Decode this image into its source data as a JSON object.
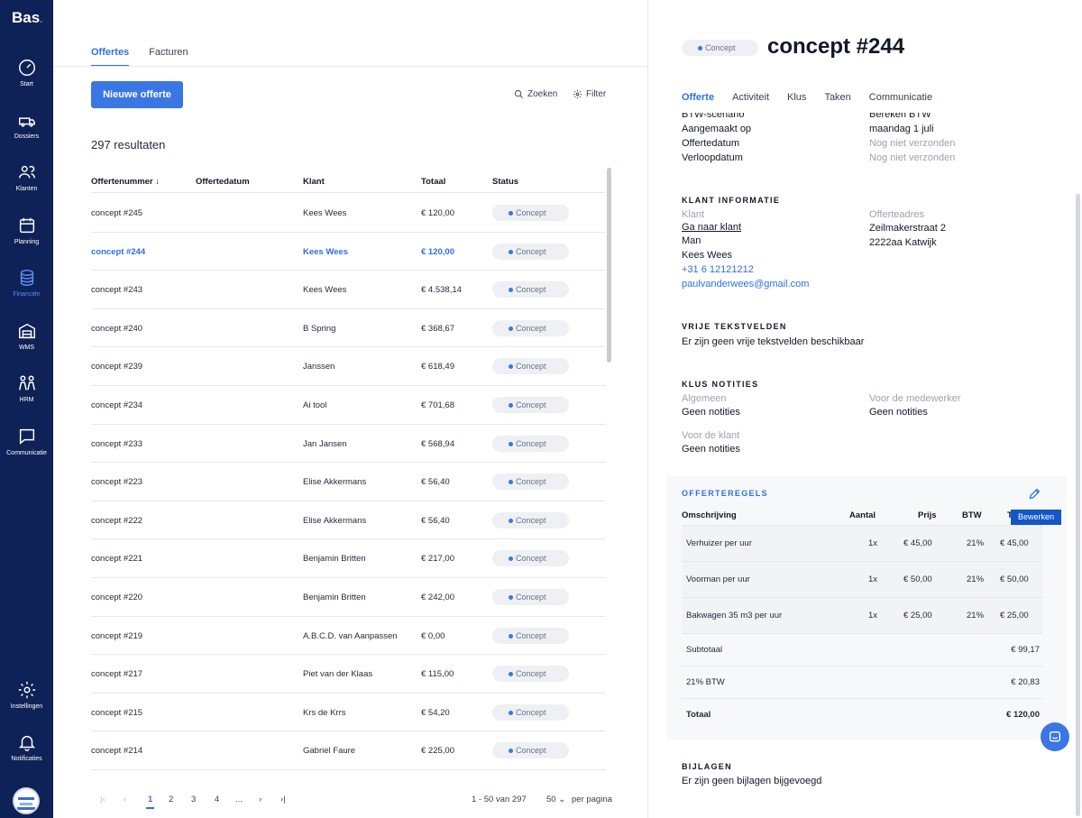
{
  "brand": {
    "name": "Bas",
    "dot": "."
  },
  "nav": {
    "start": "Start",
    "dossiers": "Dossiers",
    "klanten": "Klanten",
    "planning": "Planning",
    "financien": "Financiën",
    "wms": "WMS",
    "hrm": "HRM",
    "communicatie": "Communicatie",
    "instellingen": "Instellingen",
    "notificaties": "Notificaties"
  },
  "list": {
    "tabs": [
      "Offertes",
      "Facturen"
    ],
    "new_button": "Nieuwe offerte",
    "search_label": "Zoeken",
    "filter_label": "Filter",
    "result_count": "297 resultaten",
    "columns": [
      "Offertenummer",
      "Offertedatum",
      "Klant",
      "Totaal",
      "Status"
    ],
    "rows": [
      {
        "number": "concept #245",
        "client": "Kees Wees",
        "total": "€ 120,00",
        "status": "Concept"
      },
      {
        "number": "concept #244",
        "client": "Kees Wees",
        "total": "€ 120,00",
        "status": "Concept"
      },
      {
        "number": "concept #243",
        "client": "Kees Wees",
        "total": "€ 4.538,14",
        "status": "Concept"
      },
      {
        "number": "concept #240",
        "client": "B Spring",
        "total": "€ 368,67",
        "status": "Concept"
      },
      {
        "number": "concept #239",
        "client": "Janssen",
        "total": "€ 618,49",
        "status": "Concept"
      },
      {
        "number": "concept #234",
        "client": "Ai tool",
        "total": "€ 701,68",
        "status": "Concept"
      },
      {
        "number": "concept #233",
        "client": "Jan Jansen",
        "total": "€ 568,94",
        "status": "Concept"
      },
      {
        "number": "concept #223",
        "client": "Elise Akkermans",
        "total": "€ 56,40",
        "status": "Concept"
      },
      {
        "number": "concept #222",
        "client": "Elise Akkermans",
        "total": "€ 56,40",
        "status": "Concept"
      },
      {
        "number": "concept #221",
        "client": "Benjamin Britten",
        "total": "€ 217,00",
        "status": "Concept"
      },
      {
        "number": "concept #220",
        "client": "Benjamin Britten",
        "total": "€ 242,00",
        "status": "Concept"
      },
      {
        "number": "concept #219",
        "client": "A.B.C.D. van Aanpassen",
        "total": "€ 0,00",
        "status": "Concept"
      },
      {
        "number": "concept #217",
        "client": "Piet van der Klaas",
        "total": "€ 115,00",
        "status": "Concept"
      },
      {
        "number": "concept #215",
        "client": "Krs de Krrs",
        "total": "€ 54,20",
        "status": "Concept"
      },
      {
        "number": "concept #214",
        "client": "Gabriel Faure",
        "total": "€ 225,00",
        "status": "Concept"
      }
    ],
    "pagination": {
      "pages": [
        "1",
        "2",
        "3",
        "4",
        "..."
      ],
      "range": "1 - 50 van 297",
      "per_page": "50",
      "per_page_label": "per pagina"
    }
  },
  "detail": {
    "status": "Concept",
    "title": "concept #244",
    "tabs": [
      "Offerte",
      "Activiteit",
      "Klus",
      "Taken",
      "Communicatie"
    ],
    "meta": [
      {
        "label": "BTW-scenario",
        "value": "Bereken BTW"
      },
      {
        "label": "Aangemaakt op",
        "value": "maandag 1 juli"
      },
      {
        "label": "Offertedatum",
        "value": "Nog niet verzonden"
      },
      {
        "label": "Verloopdatum",
        "value": "Nog niet verzonden"
      }
    ],
    "client_section": "KLANT INFORMATIE",
    "client_label": "Klant",
    "client_link": "Ga naar klant",
    "client_gender": "Man",
    "client_name": "Kees Wees",
    "client_phone": "+31 6 12121212",
    "client_email": "paulvanderwees@gmail.com",
    "address_label": "Offerteadres",
    "address_street": "Zeilmakerstraat 2",
    "address_city": "2222aa Katwijk",
    "free_section": "VRIJE TEKSTVELDEN",
    "free_text": "Er zijn geen vrije tekstvelden beschikbaar",
    "notes_section": "KLUS NOTITIES",
    "notes_general_label": "Algemeen",
    "notes_general_value": "Geen notities",
    "notes_employee_label": "Voor de medewerker",
    "notes_employee_value": "Geen notities",
    "notes_client_label": "Voor de klant",
    "notes_client_value": "Geen notities",
    "lines_section": "OFFERTEREGELS",
    "edit_tooltip": "Bewerken",
    "line_columns": [
      "Omschrijving",
      "Aantal",
      "Prijs",
      "BTW",
      "T"
    ],
    "lines": [
      {
        "desc": "Verhuizer per uur",
        "qty": "1x",
        "price": "€ 45,00",
        "vat": "21%",
        "total": "€ 45,00"
      },
      {
        "desc": "Voorman per uur",
        "qty": "1x",
        "price": "€ 50,00",
        "vat": "21%",
        "total": "€ 50,00"
      },
      {
        "desc": "Bakwagen 35 m3 per uur",
        "qty": "1x",
        "price": "€ 25,00",
        "vat": "21%",
        "total": "€ 25,00"
      }
    ],
    "subtotal_label": "Subtotaal",
    "subtotal_value": "€ 99,17",
    "vat_label": "21% BTW",
    "vat_value": "€ 20,83",
    "total_label": "Totaal",
    "total_value": "€ 120,00",
    "attachments_section": "BIJLAGEN",
    "attachments_text": "Er zijn geen bijlagen bijgevoegd"
  }
}
